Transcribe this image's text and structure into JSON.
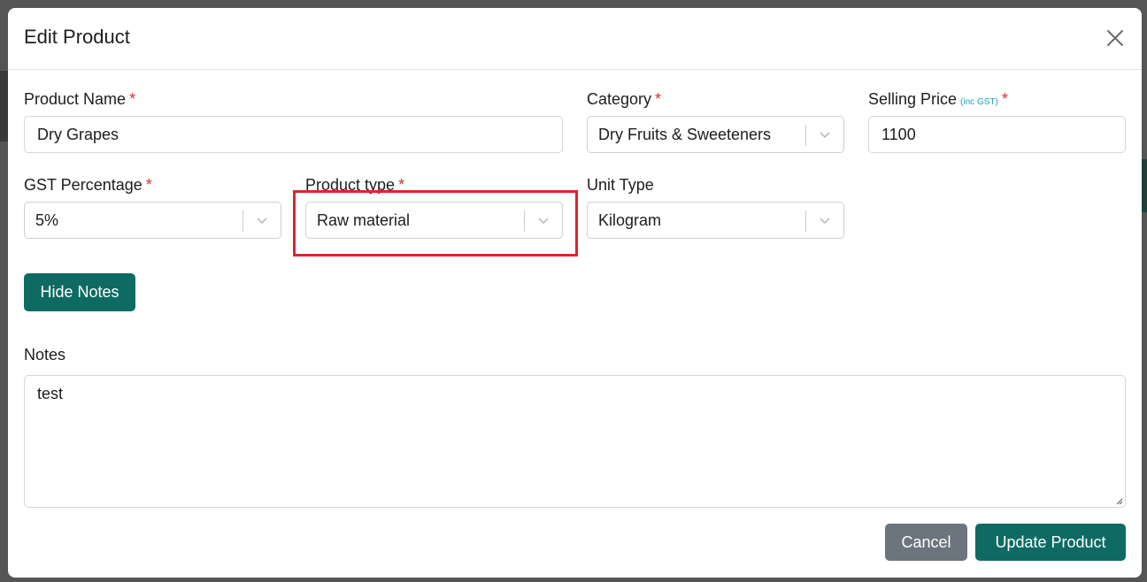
{
  "modal": {
    "title": "Edit Product"
  },
  "fields": {
    "product_name": {
      "label": "Product Name",
      "required": "*",
      "value": "Dry Grapes"
    },
    "category": {
      "label": "Category",
      "required": "*",
      "value": "Dry Fruits & Sweeteners"
    },
    "selling_price": {
      "label": "Selling Price",
      "note": "(inc GST)",
      "required": "*",
      "value": "1100"
    },
    "gst_percentage": {
      "label": "GST Percentage",
      "required": "*",
      "value": "5%"
    },
    "product_type": {
      "label": "Product type",
      "required": "*",
      "value": "Raw material"
    },
    "unit_type": {
      "label": "Unit Type",
      "value": "Kilogram"
    }
  },
  "notes": {
    "toggle_label": "Hide Notes",
    "label": "Notes",
    "value": "test"
  },
  "footer": {
    "cancel_label": "Cancel",
    "update_label": "Update Product"
  },
  "colors": {
    "primary": "#0e6b63",
    "secondary": "#6c757d",
    "required": "#d9302c",
    "highlight": "#e0242b"
  }
}
